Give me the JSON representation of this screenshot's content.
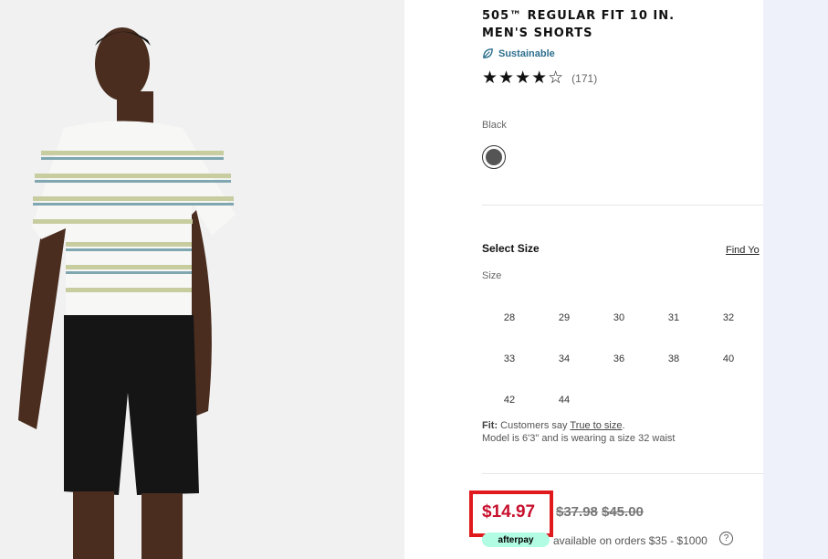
{
  "product": {
    "title_line1": "505™ REGULAR FIT 10 IN.",
    "title_line2": "MEN'S SHORTS",
    "sustainable_label": "Sustainable",
    "stars_glyphs": "★★★★☆",
    "rating": 4.5,
    "reviews": "(171)"
  },
  "color": {
    "label": "Black",
    "swatch_color": "#555555"
  },
  "size_section": {
    "title": "Select Size",
    "find_link": "Find Yo",
    "size_label": "Size",
    "sizes": [
      "28",
      "29",
      "30",
      "31",
      "32",
      "33",
      "34",
      "36",
      "38",
      "40",
      "42",
      "44"
    ]
  },
  "fit": {
    "fit_prefix": "Fit:",
    "fit_text": "Customers say",
    "fit_link": "True to size",
    "fit_end": ".",
    "model_text": "Model is 6'3\" and is wearing a size 32 waist"
  },
  "price": {
    "sale": "$14.97",
    "original1": "$37.98",
    "original2": "$45.00",
    "sale_color": "#c8102e",
    "highlight_color": "#e0191c"
  },
  "afterpay": {
    "logo": "afterpay",
    "text": "available on orders $35 - $1000",
    "help": "?"
  }
}
